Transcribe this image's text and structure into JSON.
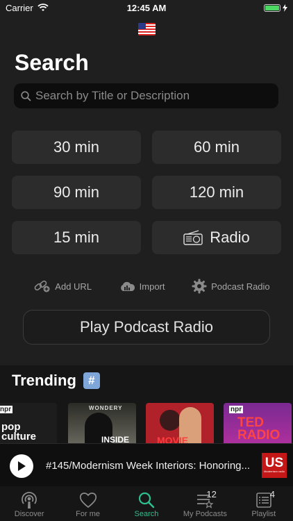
{
  "status_bar": {
    "carrier": "Carrier",
    "time": "12:45 AM"
  },
  "page": {
    "title": "Search"
  },
  "search": {
    "placeholder": "Search by Title or Description"
  },
  "durations": [
    {
      "label": "30 min"
    },
    {
      "label": "60 min"
    },
    {
      "label": "90 min"
    },
    {
      "label": "120 min"
    },
    {
      "label": "15  min"
    },
    {
      "label": "Radio",
      "icon": "radio-icon"
    }
  ],
  "actions": [
    {
      "label": "Add URL",
      "icon": "link-icon"
    },
    {
      "label": "Import",
      "icon": "cloud-icon"
    },
    {
      "label": "Podcast Radio",
      "icon": "gear-icon"
    }
  ],
  "play_radio": {
    "label": "Play Podcast Radio"
  },
  "trending": {
    "title": "Trending",
    "badge": "#",
    "covers": [
      {
        "brand": "npr",
        "text": "pop culture",
        "color": "#1d1d1d"
      },
      {
        "brand": "WONDERY",
        "text": "INSIDE",
        "color": "#3a3a34"
      },
      {
        "brand": "",
        "text": "MOVIE",
        "color": "#b0212a"
      },
      {
        "brand": "npr",
        "text": "TED RADIO",
        "color": "#8a2a9e"
      }
    ]
  },
  "now_playing": {
    "title": "#145/Modernism Week Interiors: Honoring...",
    "art_text": "US",
    "art_sub": "Modernism radio"
  },
  "tabs": [
    {
      "label": "Discover",
      "icon": "podcast-icon",
      "active": false
    },
    {
      "label": "For me",
      "icon": "heart-icon",
      "active": false
    },
    {
      "label": "Search",
      "icon": "search-icon",
      "active": true
    },
    {
      "label": "My Podcasts",
      "icon": "list-star-icon",
      "badge": "12",
      "active": false
    },
    {
      "label": "Playlist",
      "icon": "playlist-icon",
      "badge": "4",
      "active": false
    }
  ],
  "colors": {
    "accent": "#2fbf8c",
    "background": "#1f1f1f",
    "button": "#2c2c2c"
  }
}
